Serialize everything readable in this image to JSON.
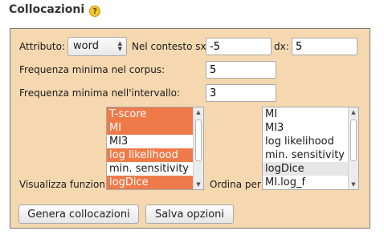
{
  "header": {
    "title": "Collocazioni",
    "help_icon": "question-mark-icon",
    "help_glyph": "?"
  },
  "form": {
    "attributo_label": "Attributo:",
    "attributo_value": "word",
    "contesto_sx_label": "Nel contesto sx:",
    "contesto_sx_value": "-5",
    "dx_label": "dx:",
    "dx_value": "5",
    "freq_corpus_label": "Frequenza minima nel corpus:",
    "freq_corpus_value": "5",
    "freq_intervallo_label": "Frequenza minima nell'intervallo:",
    "freq_intervallo_value": "3",
    "visualizza_label": "Visualizza funzioni:",
    "ordina_label": "Ordina per:"
  },
  "visualizza_options": [
    {
      "label": "T-score",
      "selected": true
    },
    {
      "label": "MI",
      "selected": true
    },
    {
      "label": "MI3",
      "selected": false
    },
    {
      "label": "log likelihood",
      "selected": true
    },
    {
      "label": "min. sensitivity",
      "selected": false
    },
    {
      "label": "logDice",
      "selected": true
    }
  ],
  "ordina_options": [
    {
      "label": "MI",
      "highlighted": false
    },
    {
      "label": "MI3",
      "highlighted": false
    },
    {
      "label": "log likelihood",
      "highlighted": false
    },
    {
      "label": "min. sensitivity",
      "highlighted": false
    },
    {
      "label": "logDice",
      "highlighted": true
    },
    {
      "label": "MI.log_f",
      "highlighted": false
    }
  ],
  "buttons": {
    "genera_label": "Genera collocazioni",
    "salva_label": "Salva opzioni"
  },
  "colors": {
    "panel_bg": "#f5d8b0",
    "selected_option_bg": "#ee7a4a",
    "highlighted_option_bg": "#e6e6e6"
  }
}
